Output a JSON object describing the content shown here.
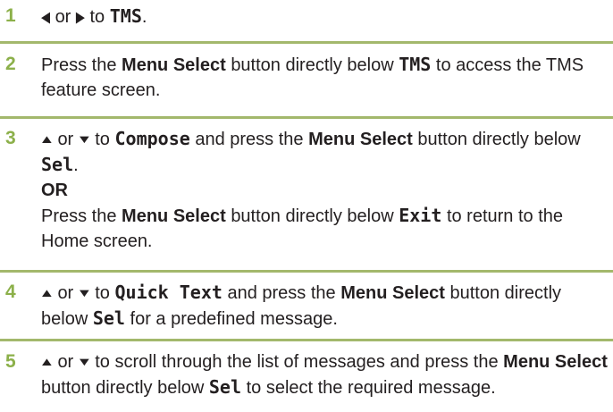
{
  "steps": [
    {
      "number": "1",
      "left_arrow": "◀",
      "or": "or",
      "right_arrow": "▶",
      "to": "to",
      "target": "TMS",
      "end": "."
    },
    {
      "number": "2",
      "press": "Press the",
      "button": "Menu Select",
      "below": "button directly below",
      "target": "TMS",
      "rest": "to access the TMS feature screen."
    },
    {
      "number": "3",
      "up_arrow": "▲",
      "or": "or",
      "down_arrow": "▼",
      "to": "to",
      "target": "Compose",
      "and_press": "and press the",
      "button": "Menu Select",
      "below": "button directly below",
      "sel": "Sel",
      "end": ".",
      "or_heading": "OR",
      "alt_press": "Press the",
      "alt_button": "Menu Select",
      "alt_below": "button directly below",
      "alt_target": "Exit",
      "alt_rest": "to return to the Home screen."
    },
    {
      "number": "4",
      "up_arrow": "▲",
      "or": "or",
      "down_arrow": "▼",
      "to": "to",
      "target": "Quick Text",
      "and_press": "and press the",
      "button": "Menu Select",
      "below": "button directly below",
      "sel": "Sel",
      "rest": "for a predefined message."
    },
    {
      "number": "5",
      "up_arrow": "▲",
      "or": "or",
      "down_arrow": "▼",
      "scroll": "to scroll through the list of messages and press the",
      "button": "Menu Select",
      "below": "button directly below",
      "sel": "Sel",
      "rest": "to select the required message."
    }
  ]
}
